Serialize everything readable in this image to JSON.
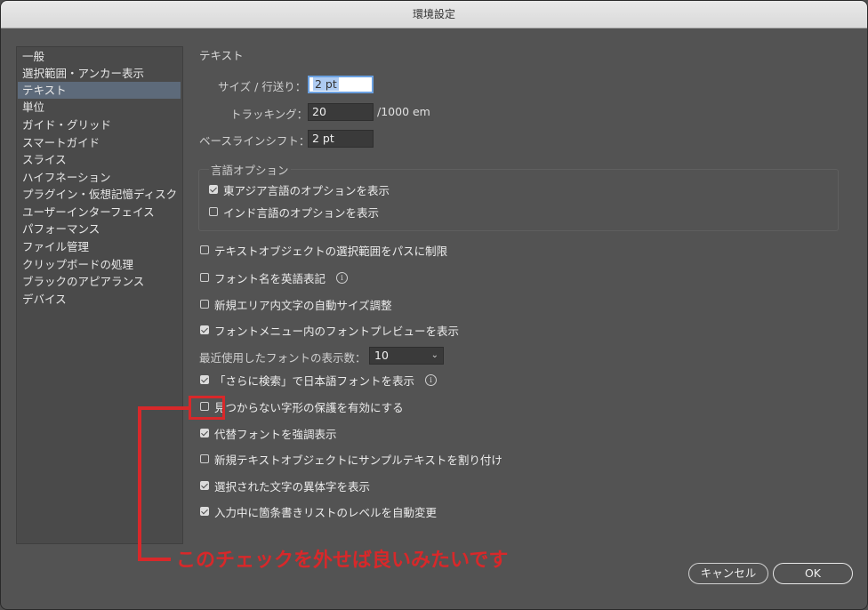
{
  "window": {
    "title": "環境設定"
  },
  "sidebar": {
    "items": [
      {
        "label": "一般"
      },
      {
        "label": "選択範囲・アンカー表示"
      },
      {
        "label": "テキスト",
        "selected": true
      },
      {
        "label": "単位"
      },
      {
        "label": "ガイド・グリッド"
      },
      {
        "label": "スマートガイド"
      },
      {
        "label": "スライス"
      },
      {
        "label": "ハイフネーション"
      },
      {
        "label": "プラグイン・仮想記憶ディスク"
      },
      {
        "label": "ユーザーインターフェイス"
      },
      {
        "label": "パフォーマンス"
      },
      {
        "label": "ファイル管理"
      },
      {
        "label": "クリップボードの処理"
      },
      {
        "label": "ブラックのアピアランス"
      },
      {
        "label": "デバイス"
      }
    ]
  },
  "section": {
    "title": "テキスト"
  },
  "fields": {
    "size_leading": {
      "label": "サイズ / 行送り：",
      "value": "2 pt"
    },
    "tracking": {
      "label": "トラッキング：",
      "value": "20",
      "unit": "/1000 em"
    },
    "baseline_shift": {
      "label": "ベースラインシフト：",
      "value": "2 pt"
    }
  },
  "language_options": {
    "title": "言語オプション",
    "items": [
      {
        "label": "東アジア言語のオプションを表示",
        "checked": true
      },
      {
        "label": "インド言語のオプションを表示",
        "checked": false
      }
    ]
  },
  "options": [
    {
      "label": "テキストオブジェクトの選択範囲をパスに制限",
      "checked": false
    },
    {
      "label": "フォント名を英語表記",
      "checked": false,
      "info": true
    },
    {
      "label": "新規エリア内文字の自動サイズ調整",
      "checked": false
    },
    {
      "label": "フォントメニュー内のフォントプレビューを表示",
      "checked": true
    }
  ],
  "recent_fonts": {
    "label": "最近使用したフォントの表示数：",
    "value": "10"
  },
  "options2": [
    {
      "label": "「さらに検索」で日本語フォントを表示",
      "checked": true,
      "info": true
    },
    {
      "label": "見つからない字形の保護を有効にする",
      "checked": false
    },
    {
      "label": "代替フォントを強調表示",
      "checked": true
    },
    {
      "label": "新規テキストオブジェクトにサンプルテキストを割り付け",
      "checked": false
    },
    {
      "label": "選択された文字の異体字を表示",
      "checked": true
    },
    {
      "label": "入力中に箇条書きリストのレベルを自動変更",
      "checked": true
    }
  ],
  "buttons": {
    "cancel": "キャンセル",
    "ok": "OK"
  },
  "info_glyph": "i",
  "chevron_glyph": "⌄",
  "annotation": {
    "text": "このチェックを外せば良いみたいです",
    "color": "#d8282a"
  }
}
